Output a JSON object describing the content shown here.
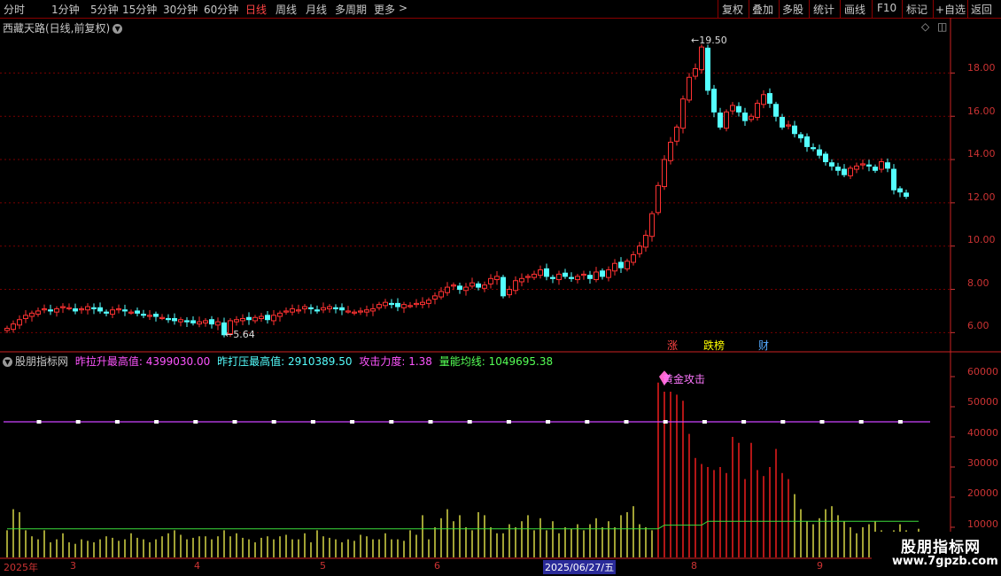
{
  "toolbar": {
    "periods": [
      "分时",
      "1分钟",
      "5分钟",
      "15分钟",
      "30分钟",
      "60分钟",
      "日线",
      "周线",
      "月线",
      "多周期",
      "更多"
    ],
    "active_period": "日线",
    "more_arrow": ">",
    "actions": [
      "复权",
      "叠加",
      "多股",
      "统计",
      "画线",
      "F10",
      "标记",
      "+自选",
      "返回"
    ]
  },
  "main_chart": {
    "title": "西藏天路(日线,前复权)",
    "price_axis": [
      "18.00",
      "16.00",
      "14.00",
      "12.00",
      "10.00",
      "8.00",
      "6.00"
    ],
    "high_label": "19.50",
    "low_label": "5.64",
    "event_tags": [
      {
        "text": "涨",
        "color": "#ff4444"
      },
      {
        "text": "跌榜",
        "color": "#ffff00"
      },
      {
        "text": "财",
        "color": "#55aaff"
      }
    ],
    "colors": {
      "up": "#ff3232",
      "down": "#54ffff",
      "grid": "#7a0000",
      "axis": "#cc3333"
    }
  },
  "indicator": {
    "name": "股朋指标网",
    "fields": [
      {
        "label": "昨拉升最高值",
        "value": "4399030.00",
        "color": "#ff55ff"
      },
      {
        "label": "昨打压最高值",
        "value": "2910389.50",
        "color": "#55ffff"
      },
      {
        "label": "攻击力度",
        "value": "1.38",
        "color": "#ff55ff"
      },
      {
        "label": "量能均线",
        "value": "1049695.38",
        "color": "#55ff55"
      }
    ],
    "signal_label": "黄金攻击",
    "volume_axis": [
      "60000",
      "50000",
      "40000",
      "30000",
      "20000",
      "10000"
    ]
  },
  "date_axis": [
    {
      "text": "2025年"
    },
    {
      "text": "3"
    },
    {
      "text": "4"
    },
    {
      "text": "5"
    },
    {
      "text": "6"
    },
    {
      "text": "2025/06/27/五",
      "highlight": true
    },
    {
      "text": "8"
    },
    {
      "text": "9"
    }
  ],
  "watermark": {
    "title": "股朋指标网",
    "url": "www.7gpzb.com"
  },
  "chart_data": {
    "type": "candlestick",
    "title": "西藏天路(日线,前复权)",
    "y_range": [
      5.4,
      19.9
    ],
    "closes": [
      6.2,
      6.4,
      6.6,
      6.8,
      6.9,
      7.0,
      7.1,
      7.0,
      7.1,
      7.2,
      7.15,
      7.0,
      7.1,
      7.2,
      7.1,
      7.0,
      6.9,
      7.05,
      7.1,
      7.0,
      6.95,
      6.9,
      6.85,
      6.8,
      6.75,
      6.7,
      6.6,
      6.55,
      6.6,
      6.5,
      6.45,
      6.5,
      6.55,
      6.4,
      6.5,
      5.9,
      6.55,
      6.6,
      6.65,
      6.6,
      6.7,
      6.75,
      6.6,
      6.8,
      6.9,
      7.0,
      7.1,
      7.05,
      7.2,
      7.1,
      7.0,
      7.15,
      7.2,
      7.1,
      7.05,
      7.0,
      6.95,
      7.0,
      7.05,
      7.1,
      7.3,
      7.4,
      7.3,
      7.2,
      7.3,
      7.25,
      7.35,
      7.4,
      7.5,
      7.7,
      7.9,
      8.1,
      8.2,
      8.0,
      8.1,
      8.3,
      8.1,
      8.2,
      8.5,
      8.6,
      7.7,
      8.0,
      8.4,
      8.5,
      8.6,
      8.7,
      8.9,
      8.6,
      8.5,
      8.7,
      8.6,
      8.5,
      8.6,
      8.7,
      8.5,
      8.8,
      8.6,
      8.9,
      9.2,
      9.0,
      9.3,
      9.6,
      10.0,
      10.5,
      11.5,
      12.8,
      14.0,
      14.8,
      15.5,
      16.8,
      17.8,
      18.2,
      19.2,
      17.2,
      16.2,
      15.5,
      16.2,
      16.5,
      16.2,
      15.8,
      16.0,
      16.6,
      17.0,
      16.6,
      16.0,
      15.5,
      15.6,
      15.2,
      15.0,
      14.6,
      14.5,
      14.2,
      13.9,
      13.7,
      13.5,
      13.3,
      13.6,
      13.7,
      13.8,
      13.7,
      13.5,
      13.9,
      13.6,
      12.6,
      12.5,
      12.3
    ],
    "price_high": 19.5,
    "price_low": 5.64,
    "volume_y_range": [
      0,
      65000
    ],
    "volume_baseline": 45000,
    "volume_ma_level": 9500,
    "volume": [
      9000,
      16000,
      15000,
      9000,
      7000,
      6000,
      9000,
      5000,
      6000,
      8000,
      5000,
      4500,
      6000,
      5500,
      5000,
      6000,
      7000,
      6500,
      5500,
      6000,
      8000,
      6500,
      6000,
      5000,
      6000,
      7000,
      8000,
      9000,
      7500,
      6000,
      6500,
      7000,
      7000,
      6000,
      7000,
      9000,
      7000,
      8000,
      6500,
      6000,
      5000,
      6500,
      7000,
      6000,
      7000,
      7500,
      6000,
      6000,
      8000,
      5000,
      9000,
      7000,
      6500,
      6000,
      5000,
      6000,
      5500,
      7500,
      7000,
      6000,
      6000,
      8000,
      6000,
      6000,
      5500,
      9000,
      7500,
      14000,
      6000,
      10000,
      13000,
      16000,
      12000,
      14000,
      10000,
      9000,
      15000,
      14000,
      10000,
      8000,
      8000,
      11000,
      10000,
      12000,
      14000,
      9000,
      13000,
      9000,
      12000,
      8000,
      10000,
      9500,
      11000,
      9000,
      11000,
      13000,
      10000,
      12000,
      10000,
      14000,
      15000,
      17000,
      11000,
      10000,
      9000,
      58000,
      55000,
      55000,
      54000,
      52000,
      41000,
      33000,
      31000,
      30000,
      29000,
      30000,
      28000,
      40000,
      38000,
      26000,
      38000,
      29000,
      27000,
      30000,
      36000,
      28000,
      26000,
      21000,
      16000,
      12000,
      11000,
      13000,
      16000,
      17000,
      14000,
      12000,
      10000,
      8000,
      10000,
      11000,
      12000,
      9000,
      8000,
      9000,
      11000,
      9000,
      8000,
      9500
    ]
  }
}
